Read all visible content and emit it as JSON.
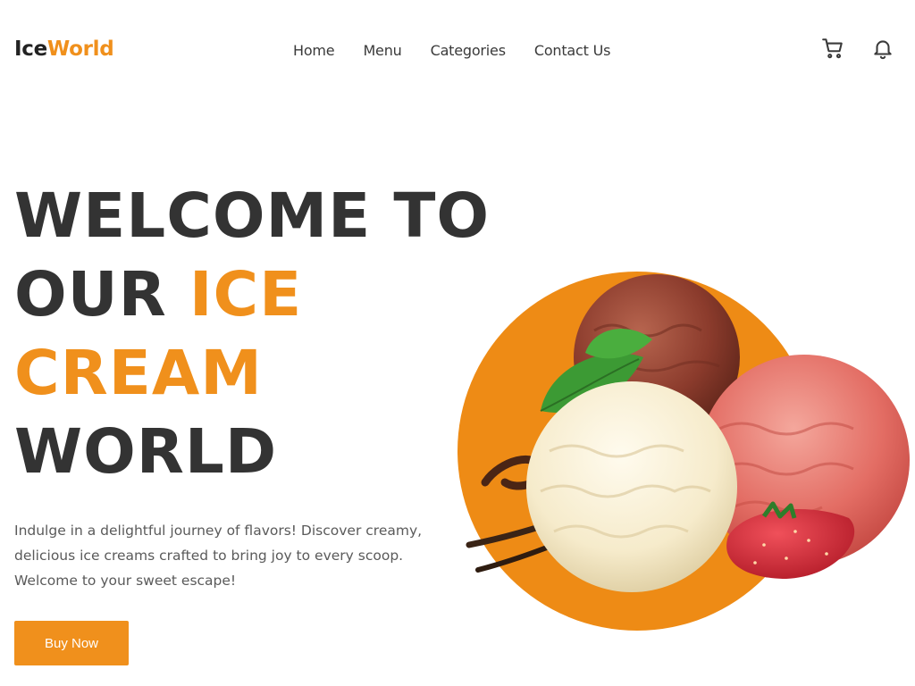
{
  "brand": {
    "part1": "Ice",
    "part2": "World"
  },
  "nav": {
    "items": [
      {
        "label": "Home"
      },
      {
        "label": "Menu"
      },
      {
        "label": "Categories"
      },
      {
        "label": "Contact Us"
      }
    ]
  },
  "header_icons": [
    "cart-icon",
    "bell-icon"
  ],
  "hero": {
    "line1": "WELCOME TO",
    "line2_plain": "OUR ",
    "line2_highlight": "ICE",
    "line3_highlight": "CREAM",
    "line4": "WORLD",
    "description": "Indulge in a delightful journey of flavors! Discover creamy, delicious ice creams crafted to bring joy to every scoop. Welcome to your sweet escape!",
    "cta_label": "Buy Now"
  },
  "colors": {
    "accent": "#f0901c",
    "heading": "#333333",
    "body_text": "#5a5a5a"
  }
}
